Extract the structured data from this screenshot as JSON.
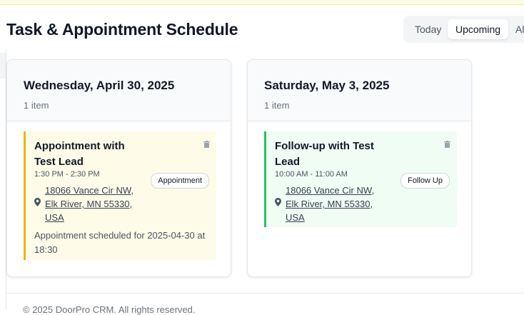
{
  "header": {
    "title": "Task & Appointment Schedule",
    "tabs": [
      {
        "label": "Today",
        "active": false
      },
      {
        "label": "Upcoming",
        "active": true
      },
      {
        "label": "Al",
        "active": false
      }
    ]
  },
  "days": [
    {
      "date": "Wednesday, April 30, 2025",
      "count": "1 item",
      "items": [
        {
          "title": "Appointment with Test Lead",
          "time": "1:30 PM - 2:30 PM",
          "address": "18066 Vance Cir NW, Elk River, MN 55330, USA",
          "type": "Appointment",
          "note": "Appointment scheduled for 2025-04-30 at 18:30",
          "accent": "#eab308",
          "background": "#fefce8"
        }
      ]
    },
    {
      "date": "Saturday, May 3, 2025",
      "count": "1 item",
      "items": [
        {
          "title": "Follow-up with Test Lead",
          "time": "10:00 AM - 11:00 AM",
          "address": "18066 Vance Cir NW, Elk River, MN 55330, USA",
          "type": "Follow Up",
          "accent": "#22c55e",
          "background": "#f0fdf4"
        }
      ]
    }
  ],
  "footer": {
    "text": "© 2025 DoorPro CRM. All rights reserved."
  },
  "icons": {
    "location": "map-pin-icon",
    "delete": "trash-icon"
  }
}
